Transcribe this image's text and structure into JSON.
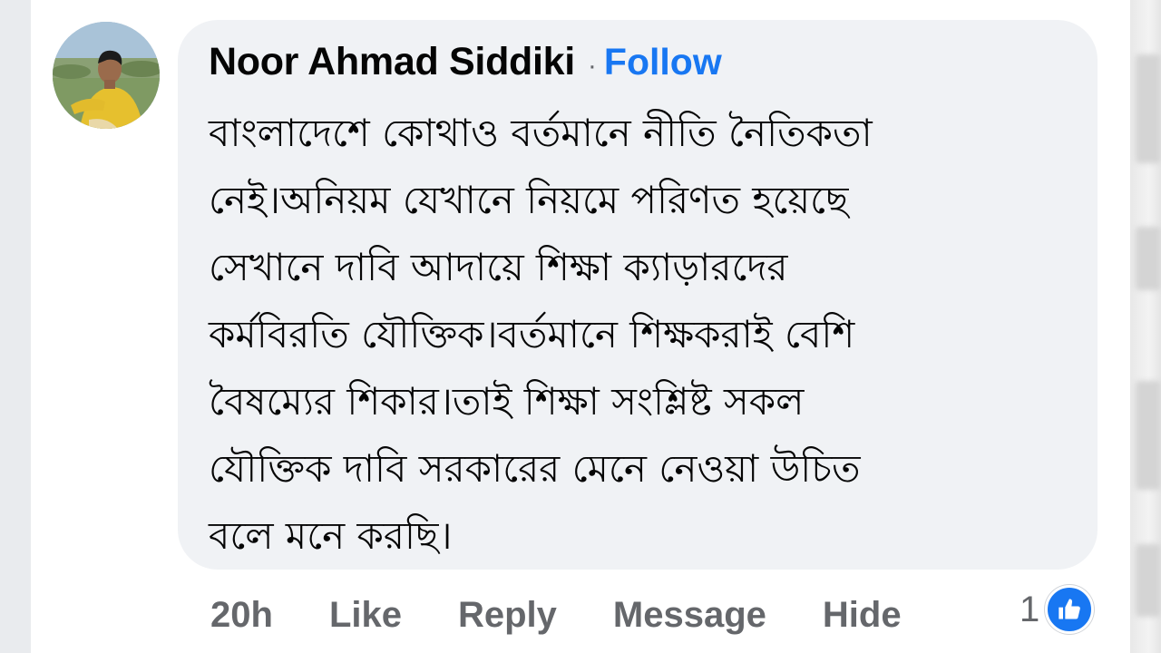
{
  "comment": {
    "author": "Noor Ahmad Siddiki",
    "separator": "·",
    "follow_label": "Follow",
    "lines": [
      "বাংলাদেশে কোথাও বর্তমানে নীতি নৈতিকতা",
      "নেই।অনিয়ম যেখানে নিয়মে পরিণত হয়েছে",
      "সেখানে দাবি আদায়ে শিক্ষা ক্যাড়ারদের",
      "কর্মবিরতি যৌক্তিক।বর্তমানে শিক্ষকরাই বেশি",
      "বৈষম্যের শিকার।তাই শিক্ষা সংশ্লিষ্ট সকল",
      "যৌক্তিক দাবি সরকারের মেনে নেওয়া উচিত",
      "বলে মনে করছি।"
    ]
  },
  "actions": {
    "time": "20h",
    "like_label": "Like",
    "reply_label": "Reply",
    "message_label": "Message",
    "hide_label": "Hide"
  },
  "reactions": {
    "count": "1",
    "icon": "thumbs-up-icon"
  },
  "colors": {
    "accent": "#1877f2",
    "bubble": "#f0f2f5",
    "muted_text": "#65676b",
    "text": "#050505"
  }
}
